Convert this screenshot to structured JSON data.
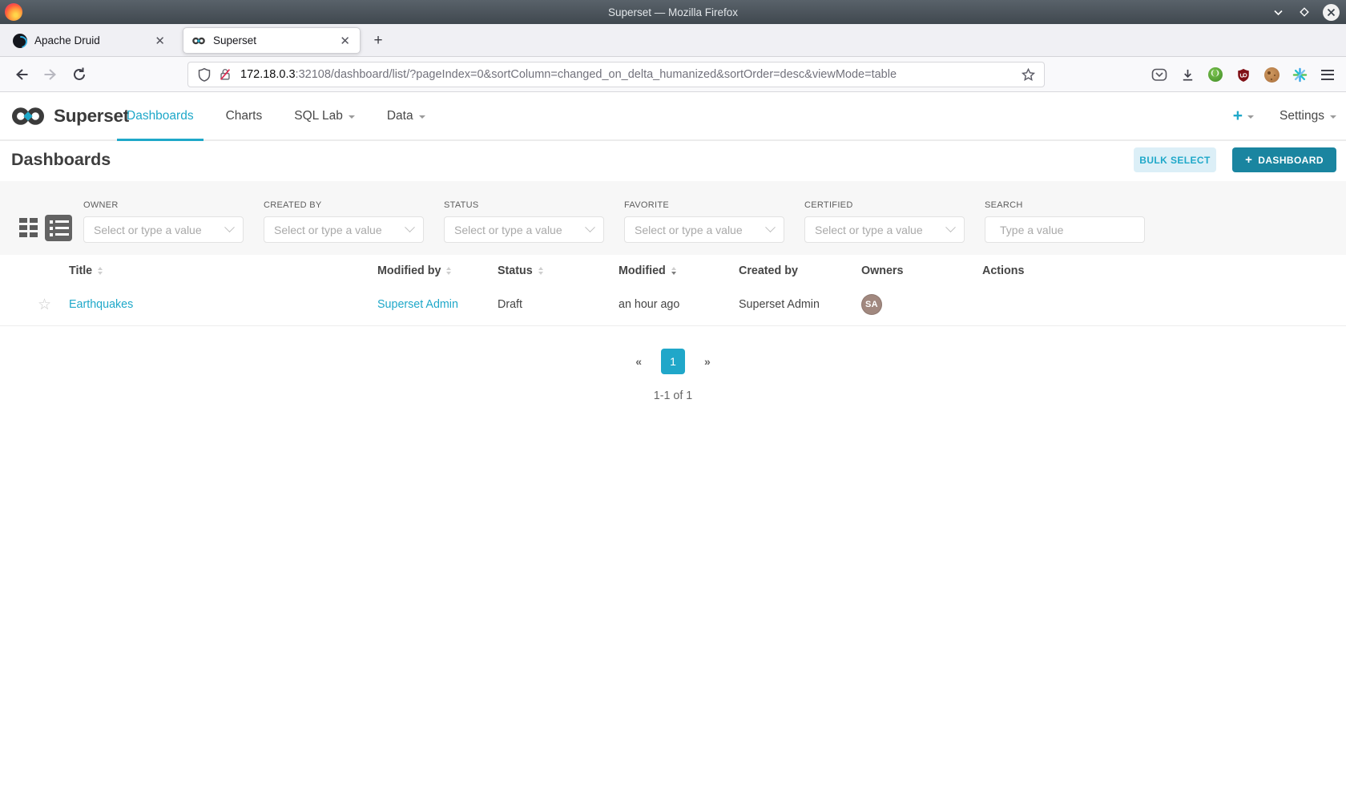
{
  "colors": {
    "accent": "#1FA8C9",
    "primary_button": "#1A85A0",
    "bulk_button_bg": "#DCEFF7",
    "avatar_bg": "#A1887F",
    "filter_band_bg": "#F7F7F7"
  },
  "titlebar": {
    "title": "Superset — Mozilla Firefox"
  },
  "tabs": [
    {
      "title": "Apache Druid"
    },
    {
      "title": "Superset"
    }
  ],
  "toolbar": {
    "url_domain": "172.18.0.3",
    "url_rest": ":32108/dashboard/list/?pageIndex=0&sortColumn=changed_on_delta_humanized&sortOrder=desc&viewMode=table"
  },
  "navbar": {
    "brand": "Superset",
    "items": [
      {
        "label": "Dashboards"
      },
      {
        "label": "Charts"
      },
      {
        "label": "SQL Lab"
      },
      {
        "label": "Data"
      }
    ],
    "new_shortcut": "+",
    "settings": "Settings"
  },
  "page": {
    "title": "Dashboards",
    "bulk_select": "BULK SELECT",
    "plus": "+",
    "new_dashboard": "DASHBOARD"
  },
  "filters": [
    {
      "label": "OWNER",
      "placeholder": "Select or type a value"
    },
    {
      "label": "CREATED BY",
      "placeholder": "Select or type a value"
    },
    {
      "label": "STATUS",
      "placeholder": "Select or type a value"
    },
    {
      "label": "FAVORITE",
      "placeholder": "Select or type a value"
    },
    {
      "label": "CERTIFIED",
      "placeholder": "Select or type a value"
    },
    {
      "label": "SEARCH",
      "placeholder": "Type a value"
    }
  ],
  "table": {
    "columns": [
      {
        "label": "Title"
      },
      {
        "label": "Modified by"
      },
      {
        "label": "Status"
      },
      {
        "label": "Modified"
      },
      {
        "label": "Created by"
      },
      {
        "label": "Owners"
      },
      {
        "label": "Actions"
      }
    ],
    "rows": [
      {
        "title": "Earthquakes",
        "modified_by": "Superset Admin",
        "status": "Draft",
        "modified": "an hour ago",
        "created_by": "Superset Admin",
        "owner_initials": "SA"
      }
    ]
  },
  "pagination": {
    "prev": "«",
    "current_page": "1",
    "next": "»",
    "summary": "1-1 of 1"
  }
}
